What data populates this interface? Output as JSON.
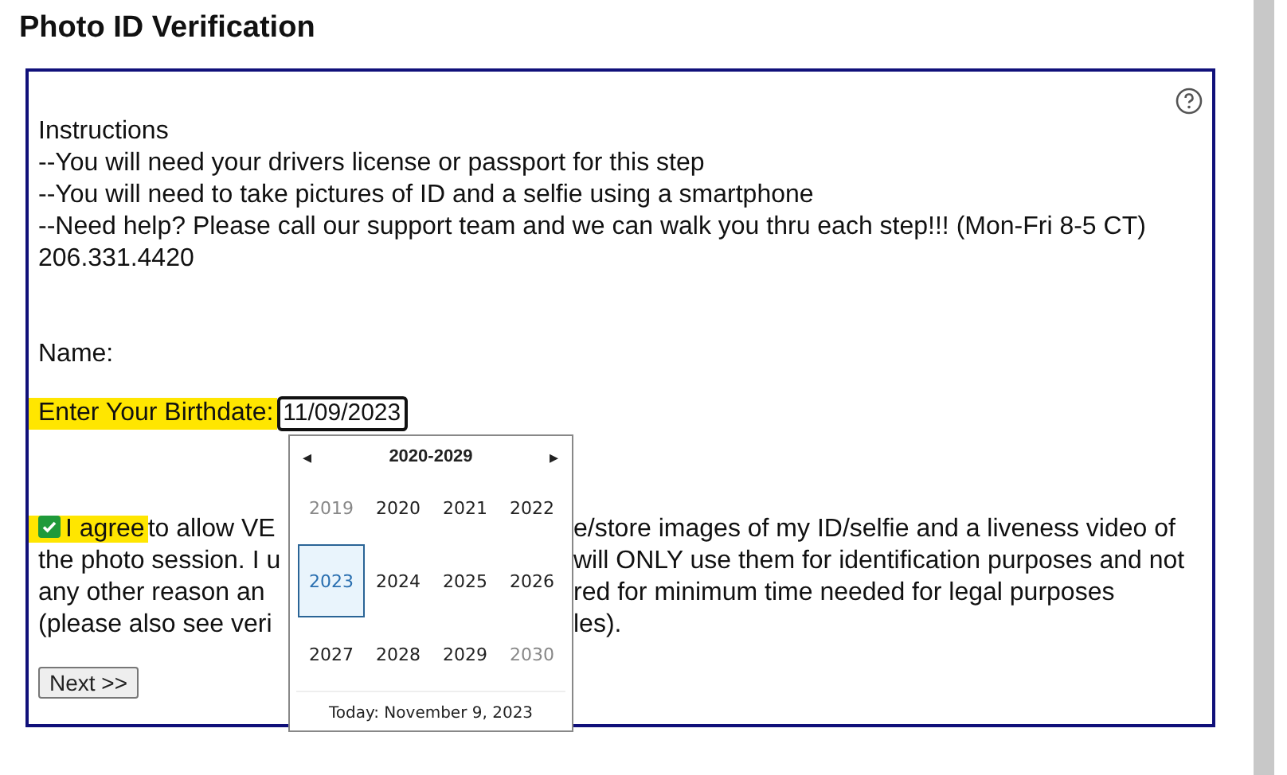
{
  "page_title": "Photo ID Verification",
  "instructions": [
    "Instructions",
    "--You will need your drivers license or passport for this step",
    "--You will need to take pictures of ID and a selfie using a smartphone",
    "--Need help? Please call our support team and we can walk you thru each step!!! (Mon-Fri 8-5 CT) 206.331.4420"
  ],
  "name_label": "Name:",
  "birthdate": {
    "label": "Enter Your Birthdate:",
    "value": "11/09/2023"
  },
  "agreement": {
    "checked": true,
    "label": "I agree",
    "lines": [
      {
        "left": "to allow VE",
        "right": "e/store images of my ID/selfie and a liveness video of"
      },
      {
        "left": "the photo session. I u",
        "right": "will ONLY use them for identification purposes and not"
      },
      {
        "left": "any other reason an",
        "right": "red for minimum time needed for legal purposes"
      },
      {
        "left": "(please also see veri",
        "right": "les)."
      }
    ]
  },
  "next_button": "Next >>",
  "year_picker": {
    "prev": "◂",
    "next": "▸",
    "range": "2020-2029",
    "years": [
      {
        "label": "2019",
        "muted": true,
        "selected": false
      },
      {
        "label": "2020",
        "muted": false,
        "selected": false
      },
      {
        "label": "2021",
        "muted": false,
        "selected": false
      },
      {
        "label": "2022",
        "muted": false,
        "selected": false
      },
      {
        "label": "2023",
        "muted": false,
        "selected": true
      },
      {
        "label": "2024",
        "muted": false,
        "selected": false
      },
      {
        "label": "2025",
        "muted": false,
        "selected": false
      },
      {
        "label": "2026",
        "muted": false,
        "selected": false
      },
      {
        "label": "2027",
        "muted": false,
        "selected": false
      },
      {
        "label": "2028",
        "muted": false,
        "selected": false
      },
      {
        "label": "2029",
        "muted": false,
        "selected": false
      },
      {
        "label": "2030",
        "muted": true,
        "selected": false
      }
    ],
    "today": "Today: November 9, 2023"
  }
}
